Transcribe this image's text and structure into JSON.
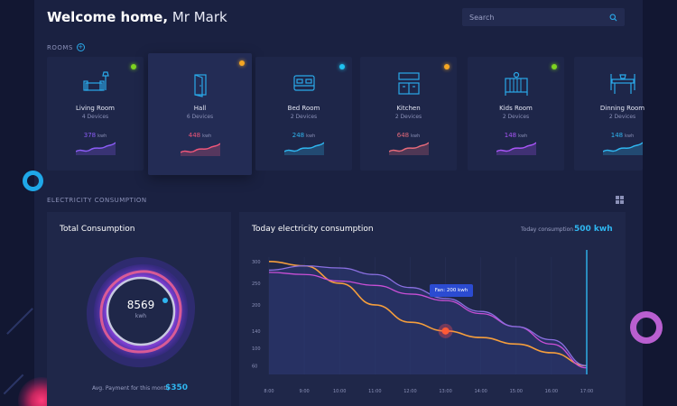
{
  "header": {
    "welcome": "Welcome home,",
    "user": "Mr Mark",
    "search_placeholder": "Search"
  },
  "rooms_label": "ROOMS",
  "rooms": [
    {
      "name": "Living Room",
      "devices": "4 Devices",
      "kwh": "378",
      "unit": "kwh",
      "status_color": "#7ed321",
      "accent": "#8b5cf6",
      "icon": "sofa-icon"
    },
    {
      "name": "Hall",
      "devices": "6 Devices",
      "kwh": "448",
      "unit": "kwh",
      "status_color": "#f5a623",
      "accent": "#f0567a",
      "icon": "door-icon"
    },
    {
      "name": "Bed Room",
      "devices": "2 Devices",
      "kwh": "248",
      "unit": "kwh",
      "status_color": "#1fc2f0",
      "accent": "#2fb6f0",
      "icon": "bed-icon"
    },
    {
      "name": "Kitchen",
      "devices": "2 Devices",
      "kwh": "648",
      "unit": "kwh",
      "status_color": "#f5a623",
      "accent": "#e66a7a",
      "icon": "kitchen-icon"
    },
    {
      "name": "Kids Room",
      "devices": "2 Devices",
      "kwh": "148",
      "unit": "kwh",
      "status_color": "#7ed321",
      "accent": "#a855f7",
      "icon": "crib-icon"
    },
    {
      "name": "Dinning Room",
      "devices": "2 Devices",
      "kwh": "148",
      "unit": "kwh",
      "status_color": "#7ed321",
      "accent": "#2fb6f0",
      "icon": "dining-icon"
    }
  ],
  "electricity_label": "ELECTRICITY CONSUMPTION",
  "total": {
    "title": "Total Consumption",
    "value": "8569",
    "unit": "kwh",
    "avg_label": "Avg. Payment for this month",
    "avg_value": "$350"
  },
  "today": {
    "title": "Today electricity consumption",
    "label": "Today consumption",
    "value": "500 kwh",
    "tooltip": "Fan: 200 kwh"
  },
  "chart_data": {
    "type": "line",
    "x": [
      "8:00",
      "9:00",
      "10:00",
      "11:00",
      "12:00",
      "13:00",
      "14:00",
      "15:00",
      "16:00",
      "17:00"
    ],
    "y_ticks": [
      60,
      100,
      140,
      200,
      250,
      300
    ],
    "ylim": [
      40,
      310
    ],
    "series": [
      {
        "color": "#f59e3c",
        "values": [
          300,
          290,
          250,
          200,
          160,
          140,
          125,
          110,
          90,
          60
        ]
      },
      {
        "color": "#c94fd6",
        "values": [
          275,
          270,
          255,
          245,
          225,
          210,
          180,
          150,
          110,
          55
        ]
      },
      {
        "color": "#8a6fe0",
        "values": [
          280,
          290,
          285,
          270,
          240,
          215,
          185,
          150,
          120,
          60
        ]
      }
    ],
    "annotation": {
      "x": "13:00",
      "y": 140,
      "label": "Fan: 200 kwh"
    }
  }
}
